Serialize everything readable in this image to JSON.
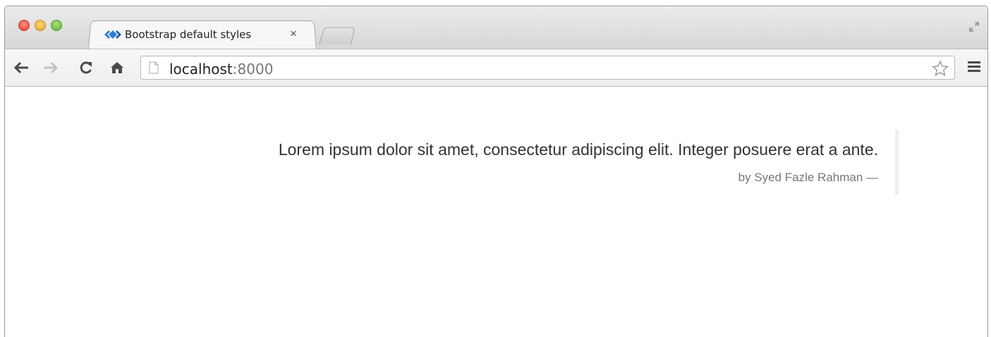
{
  "window": {
    "controls": [
      "close",
      "minimize",
      "zoom"
    ],
    "colors": {
      "close": "#e0443a",
      "minimize": "#e6a52a",
      "zoom": "#62b33c"
    }
  },
  "tab": {
    "title": "Bootstrap default styles",
    "favicon": "bootstrap-diamond-icon",
    "close_glyph": "×",
    "favicon_color": "#2a7fd4"
  },
  "toolbar": {
    "back_icon": "arrow-left-icon",
    "forward_icon": "arrow-right-icon",
    "reload_icon": "reload-icon",
    "home_icon": "home-icon",
    "bookmark_icon": "star-outline-icon",
    "menu_icon": "hamburger-menu-icon"
  },
  "address": {
    "host": "localhost",
    "port": ":8000"
  },
  "page": {
    "quote": "Lorem ipsum dolor sit amet, consectetur adipiscing elit. Integer posuere erat a ante.",
    "footer": "by Syed Fazle Rahman —"
  }
}
